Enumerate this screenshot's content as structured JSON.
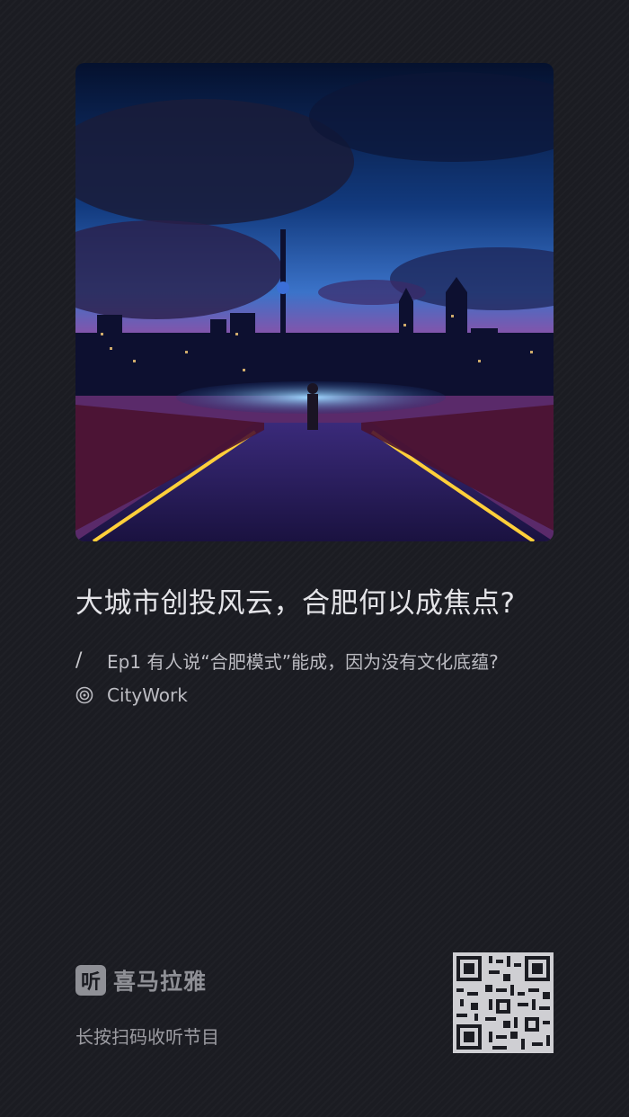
{
  "podcast": {
    "title": "大城市创投风云，合肥何以成焦点?",
    "episode_marker": "/",
    "episode_title": "Ep1 有人说“合肥模式”能成，因为没有文化底蕴?",
    "channel_name": "CityWork",
    "channel_icon": "vinyl-record-icon"
  },
  "footer": {
    "brand_glyph": "听",
    "brand_name": "喜马拉雅",
    "hint": "长按扫码收听节目"
  },
  "colors": {
    "background": "#1b1c22",
    "title": "#e4e4e8",
    "secondary": "#bdbdc3",
    "muted": "#9c9ca2"
  }
}
